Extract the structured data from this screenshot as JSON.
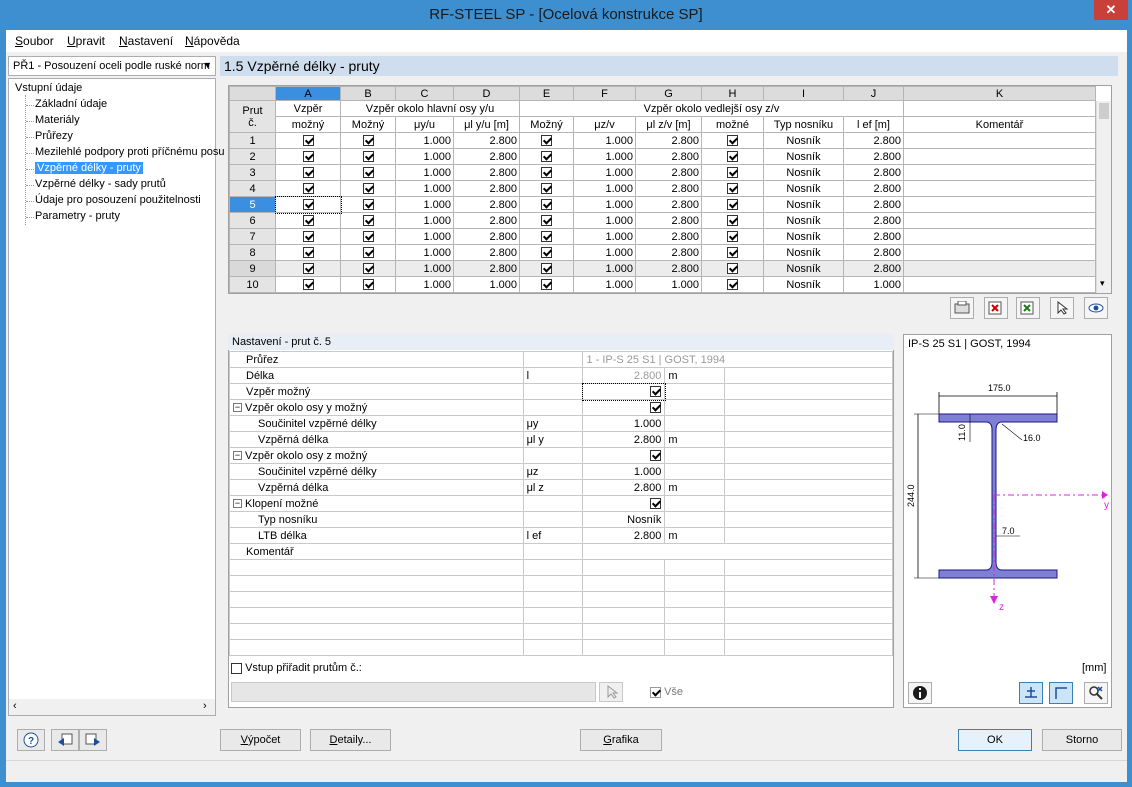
{
  "window": {
    "title": "RF-STEEL SP - [Ocelová konstrukce SP]",
    "close": "✕"
  },
  "menu": [
    {
      "label": "Soubor",
      "ul": "S",
      "rest": "oubor"
    },
    {
      "label": "Upravit",
      "ul": "U",
      "rest": "pravit"
    },
    {
      "label": "Nastavení",
      "ul": "N",
      "rest": "astavení"
    },
    {
      "label": "Nápověda",
      "ul": "N",
      "rest": "ápověda"
    }
  ],
  "case_selector": {
    "value": "PŘ1 - Posouzení oceli podle ruské norm"
  },
  "tree": {
    "root": "Vstupní údaje",
    "items": [
      "Základní údaje",
      "Materiály",
      "Průřezy",
      "Mezilehlé podpory proti příčnému posu",
      "Vzpěrné délky - pruty",
      "Vzpěrné délky - sady prutů",
      "Údaje pro posouzení použitelnosti",
      "Parametry - pruty"
    ],
    "selected_index": 4
  },
  "section_title": "1.5 Vzpěrné délky - pruty",
  "grid": {
    "letters": [
      "A",
      "B",
      "C",
      "D",
      "E",
      "F",
      "G",
      "H",
      "I",
      "J",
      "K"
    ],
    "active_letter": "A",
    "group_main": "Vzpěr okolo hlavní osy y/u",
    "group_minor": "Vzpěr okolo vedlejší osy z/v",
    "h_rownum_1": "Prut",
    "h_rownum_2": "č.",
    "h_a_1": "Vzpěr",
    "h_a_2": "možný",
    "h_b": "Možný",
    "h_c": "μy/u",
    "h_d": "μl y/u [m]",
    "h_e": "Možný",
    "h_f": "μz/v",
    "h_g": "μl z/v [m]",
    "h_h": "možné",
    "h_i": "Typ nosníku",
    "h_j": "l ef [m]",
    "h_k": "Komentář",
    "selected_row": 5,
    "rows": [
      {
        "no": "1",
        "a": true,
        "b": true,
        "c": "1.000",
        "d": "2.800",
        "e": true,
        "f": "1.000",
        "g": "2.800",
        "h": true,
        "i": "Nosník",
        "j": "2.800",
        "k": ""
      },
      {
        "no": "2",
        "a": true,
        "b": true,
        "c": "1.000",
        "d": "2.800",
        "e": true,
        "f": "1.000",
        "g": "2.800",
        "h": true,
        "i": "Nosník",
        "j": "2.800",
        "k": ""
      },
      {
        "no": "3",
        "a": true,
        "b": true,
        "c": "1.000",
        "d": "2.800",
        "e": true,
        "f": "1.000",
        "g": "2.800",
        "h": true,
        "i": "Nosník",
        "j": "2.800",
        "k": ""
      },
      {
        "no": "4",
        "a": true,
        "b": true,
        "c": "1.000",
        "d": "2.800",
        "e": true,
        "f": "1.000",
        "g": "2.800",
        "h": true,
        "i": "Nosník",
        "j": "2.800",
        "k": ""
      },
      {
        "no": "5",
        "a": true,
        "b": true,
        "c": "1.000",
        "d": "2.800",
        "e": true,
        "f": "1.000",
        "g": "2.800",
        "h": true,
        "i": "Nosník",
        "j": "2.800",
        "k": ""
      },
      {
        "no": "6",
        "a": true,
        "b": true,
        "c": "1.000",
        "d": "2.800",
        "e": true,
        "f": "1.000",
        "g": "2.800",
        "h": true,
        "i": "Nosník",
        "j": "2.800",
        "k": ""
      },
      {
        "no": "7",
        "a": true,
        "b": true,
        "c": "1.000",
        "d": "2.800",
        "e": true,
        "f": "1.000",
        "g": "2.800",
        "h": true,
        "i": "Nosník",
        "j": "2.800",
        "k": ""
      },
      {
        "no": "8",
        "a": true,
        "b": true,
        "c": "1.000",
        "d": "2.800",
        "e": true,
        "f": "1.000",
        "g": "2.800",
        "h": true,
        "i": "Nosník",
        "j": "2.800",
        "k": ""
      },
      {
        "no": "9",
        "a": true,
        "b": true,
        "c": "1.000",
        "d": "2.800",
        "e": true,
        "f": "1.000",
        "g": "2.800",
        "h": true,
        "i": "Nosník",
        "j": "2.800",
        "k": ""
      },
      {
        "no": "10",
        "a": true,
        "b": true,
        "c": "1.000",
        "d": "1.000",
        "e": true,
        "f": "1.000",
        "g": "1.000",
        "h": true,
        "i": "Nosník",
        "j": "1.000",
        "k": ""
      }
    ]
  },
  "settings": {
    "title": "Nastavení - prut č. 5",
    "rows": [
      {
        "label": "Průřez",
        "sym": "",
        "val": "1 - IP-S 25 S1 | GOST, 1994",
        "unit": "",
        "indent": 0,
        "check": null,
        "grey": true,
        "wide": true
      },
      {
        "label": "Délka",
        "sym": "l",
        "val": "2.800",
        "unit": "m",
        "indent": 0,
        "check": null,
        "grey": true
      },
      {
        "label": "Vzpěr možný",
        "sym": "",
        "val": "",
        "unit": "",
        "indent": 0,
        "check": true
      },
      {
        "label": "Vzpěr okolo osy y možný",
        "sym": "",
        "val": "",
        "unit": "",
        "indent": 0,
        "check": true,
        "group": true
      },
      {
        "label": "Součinitel vzpěrné délky",
        "sym": "μy",
        "val": "1.000",
        "unit": "",
        "indent": 1,
        "check": null
      },
      {
        "label": "Vzpěrná délka",
        "sym": "μl y",
        "val": "2.800",
        "unit": "m",
        "indent": 1,
        "check": null
      },
      {
        "label": "Vzpěr okolo osy z možný",
        "sym": "",
        "val": "",
        "unit": "",
        "indent": 0,
        "check": true,
        "group": true
      },
      {
        "label": "Součinitel vzpěrné délky",
        "sym": "μz",
        "val": "1.000",
        "unit": "",
        "indent": 1,
        "check": null
      },
      {
        "label": "Vzpěrná délka",
        "sym": "μl z",
        "val": "2.800",
        "unit": "m",
        "indent": 1,
        "check": null
      },
      {
        "label": "Klopení možné",
        "sym": "",
        "val": "",
        "unit": "",
        "indent": 0,
        "check": true,
        "group": true
      },
      {
        "label": "Typ nosníku",
        "sym": "",
        "val": "Nosník",
        "unit": "",
        "indent": 1,
        "check": null
      },
      {
        "label": "LTB délka",
        "sym": "l ef",
        "val": "2.800",
        "unit": "m",
        "indent": 1,
        "check": null
      },
      {
        "label": "Komentář",
        "sym": "",
        "val": "",
        "unit": "",
        "indent": 0,
        "check": null,
        "wide": true
      }
    ],
    "assign_label": "Vstup přiřadit prutům č.:",
    "assign_value": "",
    "all_label": "Vše"
  },
  "preview": {
    "title": "IP-S 25 S1 | GOST, 1994",
    "dim_width": "175.0",
    "dim_flange": "11.0",
    "dim_radius": "16.0",
    "dim_height": "244.0",
    "dim_web": "7.0",
    "axis_y": "y",
    "axis_z": "z",
    "unit": "[mm]"
  },
  "buttons": {
    "calc": "Výpočet",
    "calc_ul": "V",
    "calc_rest": "ýpočet",
    "details": "Detaily...",
    "details_ul": "D",
    "details_rest": "etaily...",
    "graphics": "Grafika",
    "graphics_ul": "G",
    "graphics_rest": "rafika",
    "ok": "OK",
    "cancel": "Storno"
  },
  "colors": {
    "accent": "#3b8fe0",
    "section_fill": "#7f7fd4",
    "axis": "#e020e0"
  }
}
